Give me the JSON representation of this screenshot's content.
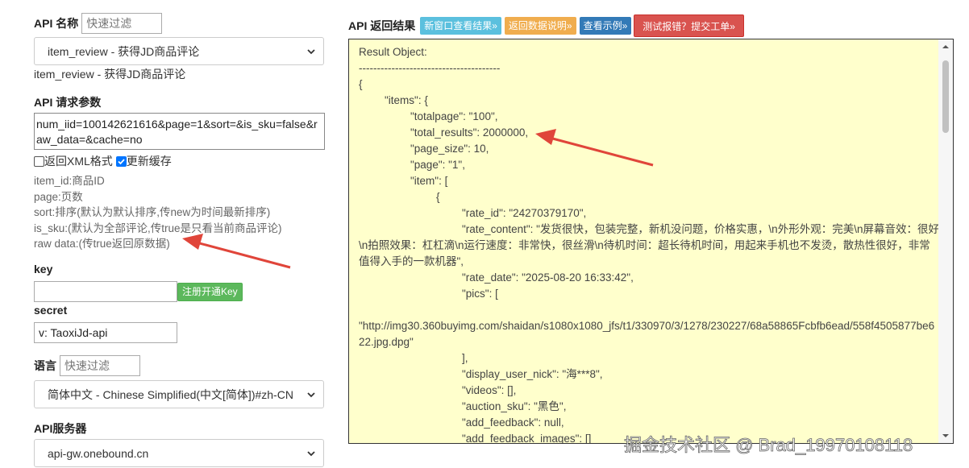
{
  "api_name": {
    "label": "API 名称",
    "filter_placeholder": "快速过滤",
    "selected": "item_review - 获得JD商品评论",
    "caption": "item_review - 获得JD商品评论"
  },
  "request_params": {
    "label": "API 请求参数",
    "value": "num_iid=100142621616&page=1&sort=&is_sku=false&raw_data=&cache=no",
    "xml_label": "返回XML格式",
    "xml_checked": false,
    "cache_label": "更新缓存",
    "cache_checked": true
  },
  "param_help": [
    "item_id:商品ID",
    "page:页数",
    "sort:排序(默认为默认排序,传new为时间最新排序)",
    "is_sku:(默认为全部评论,传true是只看当前商品评论)",
    "raw data:(传true返回原数据)"
  ],
  "key": {
    "label": "key",
    "value": "",
    "register_button": "注册开通Key"
  },
  "secret": {
    "label": "secret",
    "value": "v: TaoxiJd-api"
  },
  "language": {
    "label": "语言",
    "filter_placeholder": "快速过滤",
    "selected": "简体中文 - Chinese Simplified(中文[简体])#zh-CN"
  },
  "server": {
    "label": "API服务器",
    "selected": "api-gw.onebound.cn"
  },
  "result": {
    "label": "API 返回结果",
    "buttons": {
      "new_window": "新窗口查看结果»",
      "data_doc": "返回数据说明»",
      "example": "查看示例»",
      "report": "测试报错？提交工单»"
    },
    "lines": [
      {
        "indent": 0,
        "text": "Result Object:"
      },
      {
        "indent": 0,
        "text": "---------------------------------------"
      },
      {
        "indent": 0,
        "text": "{"
      },
      {
        "indent": 1,
        "text": "\"items\": {"
      },
      {
        "indent": 2,
        "text": "\"totalpage\": \"100\","
      },
      {
        "indent": 2,
        "text": "\"total_results\": 2000000,"
      },
      {
        "indent": 2,
        "text": "\"page_size\": 10,"
      },
      {
        "indent": 2,
        "text": "\"page\": \"1\","
      },
      {
        "indent": 2,
        "text": "\"item\": ["
      },
      {
        "indent": 3,
        "text": "{"
      },
      {
        "indent": 4,
        "text": "\"rate_id\": \"24270379170\","
      },
      {
        "indent": 4,
        "wrap": true,
        "text": "\"rate_content\": \"发货很快，包装完整，新机没问题，价格实惠，\\n外形外观：完美\\n屏幕音效：很好\\n拍照效果：杠杠滴\\n运行速度：非常快，很丝滑\\n待机时间：超长待机时间，用起来手机也不发烫，散热性很好，非常值得入手的一款机器\","
      },
      {
        "indent": 4,
        "text": "\"rate_date\": \"2025-08-20 16:33:42\","
      },
      {
        "indent": 4,
        "text": "\"pics\": ["
      },
      {
        "indent": 0,
        "text": ""
      },
      {
        "indent": 0,
        "wrap": true,
        "text": "\"http://img30.360buyimg.com/shaidan/s1080x1080_jfs/t1/330970/3/1278/230227/68a58865Fcbfb6ead/558f4505877be622.jpg.dpg\""
      },
      {
        "indent": 4,
        "text": "],"
      },
      {
        "indent": 4,
        "text": "\"display_user_nick\": \"海***8\","
      },
      {
        "indent": 4,
        "text": "\"videos\": [],"
      },
      {
        "indent": 4,
        "text": "\"auction_sku\": \"黑色\","
      },
      {
        "indent": 4,
        "text": "\"add_feedback\": null,"
      },
      {
        "indent": 4,
        "text": "\"add_feedback_images\": []"
      }
    ]
  },
  "watermark": "掘金技术社区 @ Brad_19970108118",
  "colors": {
    "btn_blue": "#5bc0de",
    "btn_orange": "#f0ad4e",
    "btn_darkblue": "#337ab7",
    "btn_red": "#d9534f",
    "btn_green": "#5cb85c",
    "arrow": "#e0453a",
    "result_bg": "#ffffcc"
  }
}
